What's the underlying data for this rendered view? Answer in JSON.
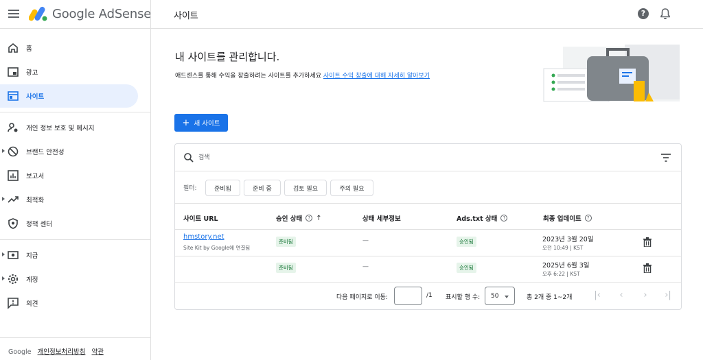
{
  "header": {
    "brand": "Google AdSense",
    "page_label": "사이트",
    "help_icon": "?"
  },
  "sidebar": {
    "items": [
      {
        "label": "홈",
        "icon": "home-icon"
      },
      {
        "label": "광고",
        "icon": "ads-icon"
      },
      {
        "label": "사이트",
        "icon": "sites-icon",
        "active": true
      },
      {
        "label": "개인 정보 보호 및 메시지",
        "icon": "privacy-icon"
      },
      {
        "label": "브랜드 안전성",
        "icon": "block-icon"
      },
      {
        "label": "보고서",
        "icon": "reports-icon"
      },
      {
        "label": "최적화",
        "icon": "trending-icon"
      },
      {
        "label": "정책 센터",
        "icon": "shield-icon"
      },
      {
        "label": "지급",
        "icon": "payments-icon"
      },
      {
        "label": "계정",
        "icon": "gear-icon"
      },
      {
        "label": "의견",
        "icon": "feedback-icon"
      }
    ],
    "footer": {
      "google": "Google",
      "privacy": "개인정보처리방침",
      "terms": "약관"
    }
  },
  "main": {
    "title": "내 사이트를 관리합니다.",
    "description": "애드센스를 통해 수익을 창출하려는 사이트를 추가하세요",
    "learn_link": "사이트 수익 창출에 대해 자세히 알아보기",
    "new_site_button": "새 사이트"
  },
  "table": {
    "search_placeholder": "검색",
    "filter_label": "필터:",
    "filter_chips": [
      "준비됨",
      "준비 중",
      "검토 필요",
      "주의 필요"
    ],
    "columns": [
      "사이트 URL",
      "승인 상태",
      "상태 세부정보",
      "Ads.txt 상태",
      "최종 업데이트"
    ],
    "rows": [
      {
        "url": "hmstory.net",
        "sub": "Site Kit by Google에 연결됨",
        "approval": "준비됨",
        "details": "—",
        "ads_txt": "승인됨",
        "date": "2023년 3월 20일",
        "time": "오전 10:49 | KST"
      },
      {
        "url": "",
        "sub": "",
        "approval": "준비됨",
        "details": "—",
        "ads_txt": "승인됨",
        "date": "2025년 6월 3일",
        "time": "오후 6:22 | KST"
      }
    ],
    "pagination": {
      "goto_label": "다음 페이지로 이동:",
      "page_total": "/1",
      "rows_label": "표시할 행 수:",
      "rows_value": "50",
      "range_text": "총 2개 중 1~2개"
    }
  }
}
